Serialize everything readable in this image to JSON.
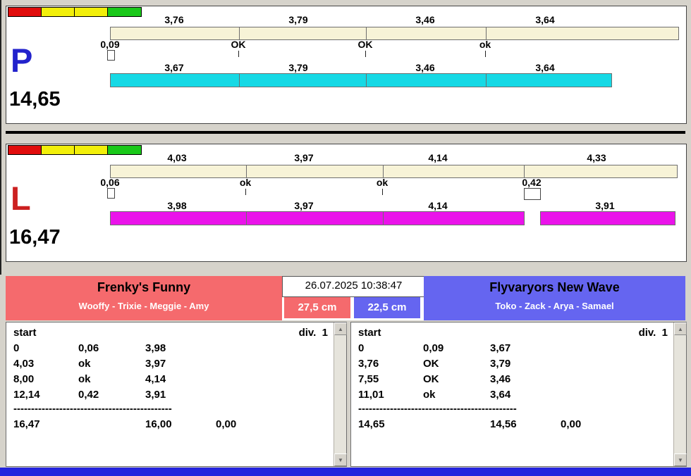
{
  "icons": {
    "up": "▲",
    "down": "▼"
  },
  "colors": {
    "light_red": "#e10d0d",
    "light_yellow": "#f2ef0a",
    "light_green": "#19c819",
    "reference_bar": "#f7f3d7",
    "lane_p_bar": "#16d9e5",
    "lane_l_bar": "#ea13ea",
    "home_team_accent": "#f56a6d",
    "guest_team_accent": "#6565f0",
    "bottom_strip": "#2323dd",
    "lane_p_letter": "#2222cc",
    "lane_l_letter": "#cc2020"
  },
  "lanes": {
    "p": {
      "letter": "P",
      "total": "14,65",
      "ref_splits": [
        "3,76",
        "3,79",
        "3,46",
        "3,64"
      ],
      "marks": [
        "0,09",
        "OK",
        "OK",
        "ok"
      ],
      "run_splits": [
        "3,67",
        "3,79",
        "3,46",
        "3,64"
      ]
    },
    "l": {
      "letter": "L",
      "total": "16,47",
      "ref_splits": [
        "4,03",
        "3,97",
        "4,14",
        "4,33"
      ],
      "marks": [
        "0,06",
        "ok",
        "ok",
        "0,42"
      ],
      "run_splits": [
        "3,98",
        "3,97",
        "4,14",
        "3,91"
      ]
    }
  },
  "footer": {
    "datetime": "26.07.2025 10:38:47",
    "left_team": {
      "name": "Frenky's Funny",
      "dogs": "Wooffy - Trixie - Meggie - Amy",
      "height": "27,5 cm"
    },
    "right_team": {
      "name": "Flyvaryors New Wave",
      "dogs": "Toko - Zack - Arya - Samael",
      "height": "22,5 cm"
    }
  },
  "results": {
    "left": {
      "start_label": "start",
      "div_label": "div.  1",
      "rows": [
        {
          "c1": "0",
          "c2": "0,06",
          "c3": "3,98"
        },
        {
          "c1": "4,03",
          "c2": "ok",
          "c3": "3,97"
        },
        {
          "c1": "8,00",
          "c2": "ok",
          "c3": "4,14"
        },
        {
          "c1": "12,14",
          "c2": "0,42",
          "c3": "3,91"
        }
      ],
      "separator": "---------------------------------------------",
      "total": "16,47",
      "clean_time": "16,00",
      "penalty": "0,00"
    },
    "right": {
      "start_label": "start",
      "div_label": "div.  1",
      "rows": [
        {
          "c1": "0",
          "c2": "0,09",
          "c3": "3,67"
        },
        {
          "c1": "3,76",
          "c2": "OK",
          "c3": "3,79"
        },
        {
          "c1": "7,55",
          "c2": "OK",
          "c3": "3,46"
        },
        {
          "c1": "11,01",
          "c2": "ok",
          "c3": "3,64"
        }
      ],
      "separator": "---------------------------------------------",
      "total": "14,65",
      "clean_time": "14,56",
      "penalty": "0,00"
    }
  }
}
